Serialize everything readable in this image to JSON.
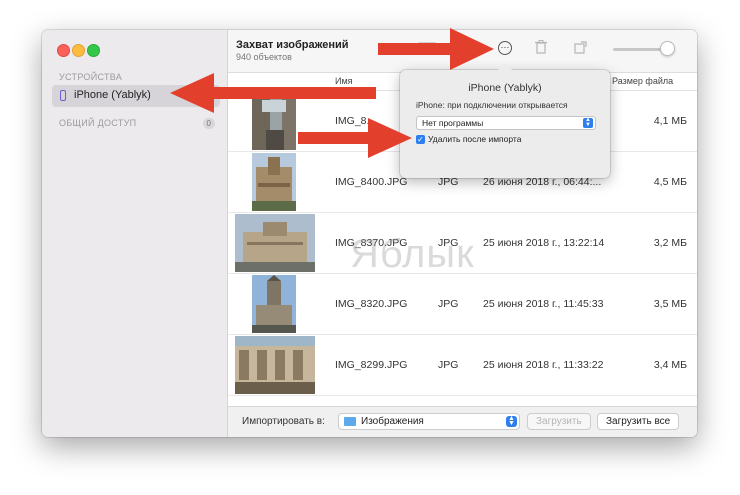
{
  "sidebar": {
    "devices_header": "УСТРОЙСТВА",
    "device_name": "iPhone (Yablyk)",
    "shared_header": "ОБЩИЙ ДОСТУП",
    "shared_count": "0"
  },
  "toolbar": {
    "title": "Захват изображений",
    "subtitle": "940 объектов"
  },
  "columns": {
    "name": "Имя",
    "size": "Размер файла"
  },
  "rows": [
    {
      "name": "IMG_8...",
      "type": "",
      "date": "",
      "size": "4,1 МБ"
    },
    {
      "name": "IMG_8400.JPG",
      "type": "JPG",
      "date": "26 июня 2018 г., 06:44:...",
      "size": "4,5 МБ"
    },
    {
      "name": "IMG_8370.JPG",
      "type": "JPG",
      "date": "25 июня 2018 г., 13:22:14",
      "size": "3,2 МБ"
    },
    {
      "name": "IMG_8320.JPG",
      "type": "JPG",
      "date": "25 июня 2018 г., 11:45:33",
      "size": "3,5 МБ"
    },
    {
      "name": "IMG_8299.JPG",
      "type": "JPG",
      "date": "25 июня 2018 г., 11:33:22",
      "size": "3,4 МБ"
    }
  ],
  "popover": {
    "title": "iPhone (Yablyk)",
    "caption": "iPhone: при подключении открывается",
    "app_select": "Нет программы",
    "delete_after_import": "Удалить после импорта",
    "delete_checked": true
  },
  "bottom": {
    "import_label": "Импортировать в:",
    "folder": "Изображения",
    "import_button": "Загрузить",
    "import_all_button": "Загрузить все"
  },
  "watermark": "Яблык",
  "colors": {
    "accent": "#2d7ff0",
    "annotation_arrow": "#e2402d"
  }
}
